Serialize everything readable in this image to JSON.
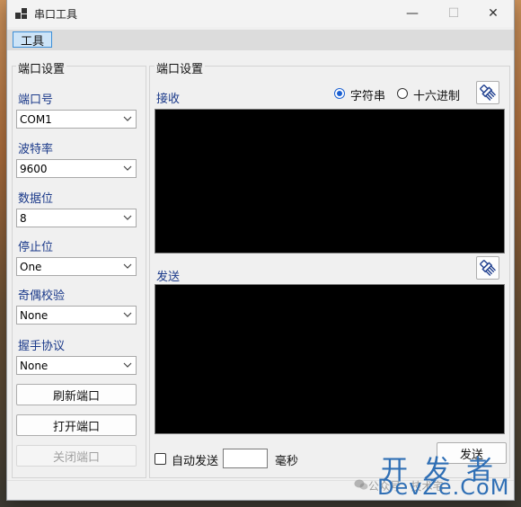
{
  "window": {
    "title": "串口工具",
    "controls": {
      "minimize": "—",
      "maximize": "☐",
      "close": "✕"
    }
  },
  "menu": {
    "items": [
      "工具"
    ]
  },
  "port_settings": {
    "group_title": "端口设置",
    "port_label": "端口号",
    "port_value": "COM1",
    "baud_label": "波特率",
    "baud_value": "9600",
    "databits_label": "数据位",
    "databits_value": "8",
    "stopbits_label": "停止位",
    "stopbits_value": "One",
    "parity_label": "奇偶校验",
    "parity_value": "None",
    "handshake_label": "握手协议",
    "handshake_value": "None",
    "refresh_button": "刷新端口",
    "open_button": "打开端口",
    "close_button": "关闭端口"
  },
  "io_panel": {
    "group_title": "端口设置",
    "receive_label": "接收",
    "display_mode": {
      "options": [
        "字符串",
        "十六进制"
      ],
      "selected": "字符串"
    },
    "send_label": "发送",
    "auto_send_label": "自动发送",
    "auto_send_checked": false,
    "interval_value": "",
    "interval_unit": "毫秒",
    "send_button": "发送"
  },
  "watermark": {
    "top": "开 发 者",
    "bottom": "DevZe.CoM",
    "faint": "公众号 · 技术宅"
  },
  "icons": {
    "app": "app-grid-icon",
    "clear": "brush-icon",
    "dropdown": "chevron-down-icon"
  },
  "colors": {
    "label_blue": "#1b3a8a",
    "radio_accent": "#1a5fd1",
    "menu_highlight": "#cde4f7",
    "watermark": "#2f6fb5"
  }
}
